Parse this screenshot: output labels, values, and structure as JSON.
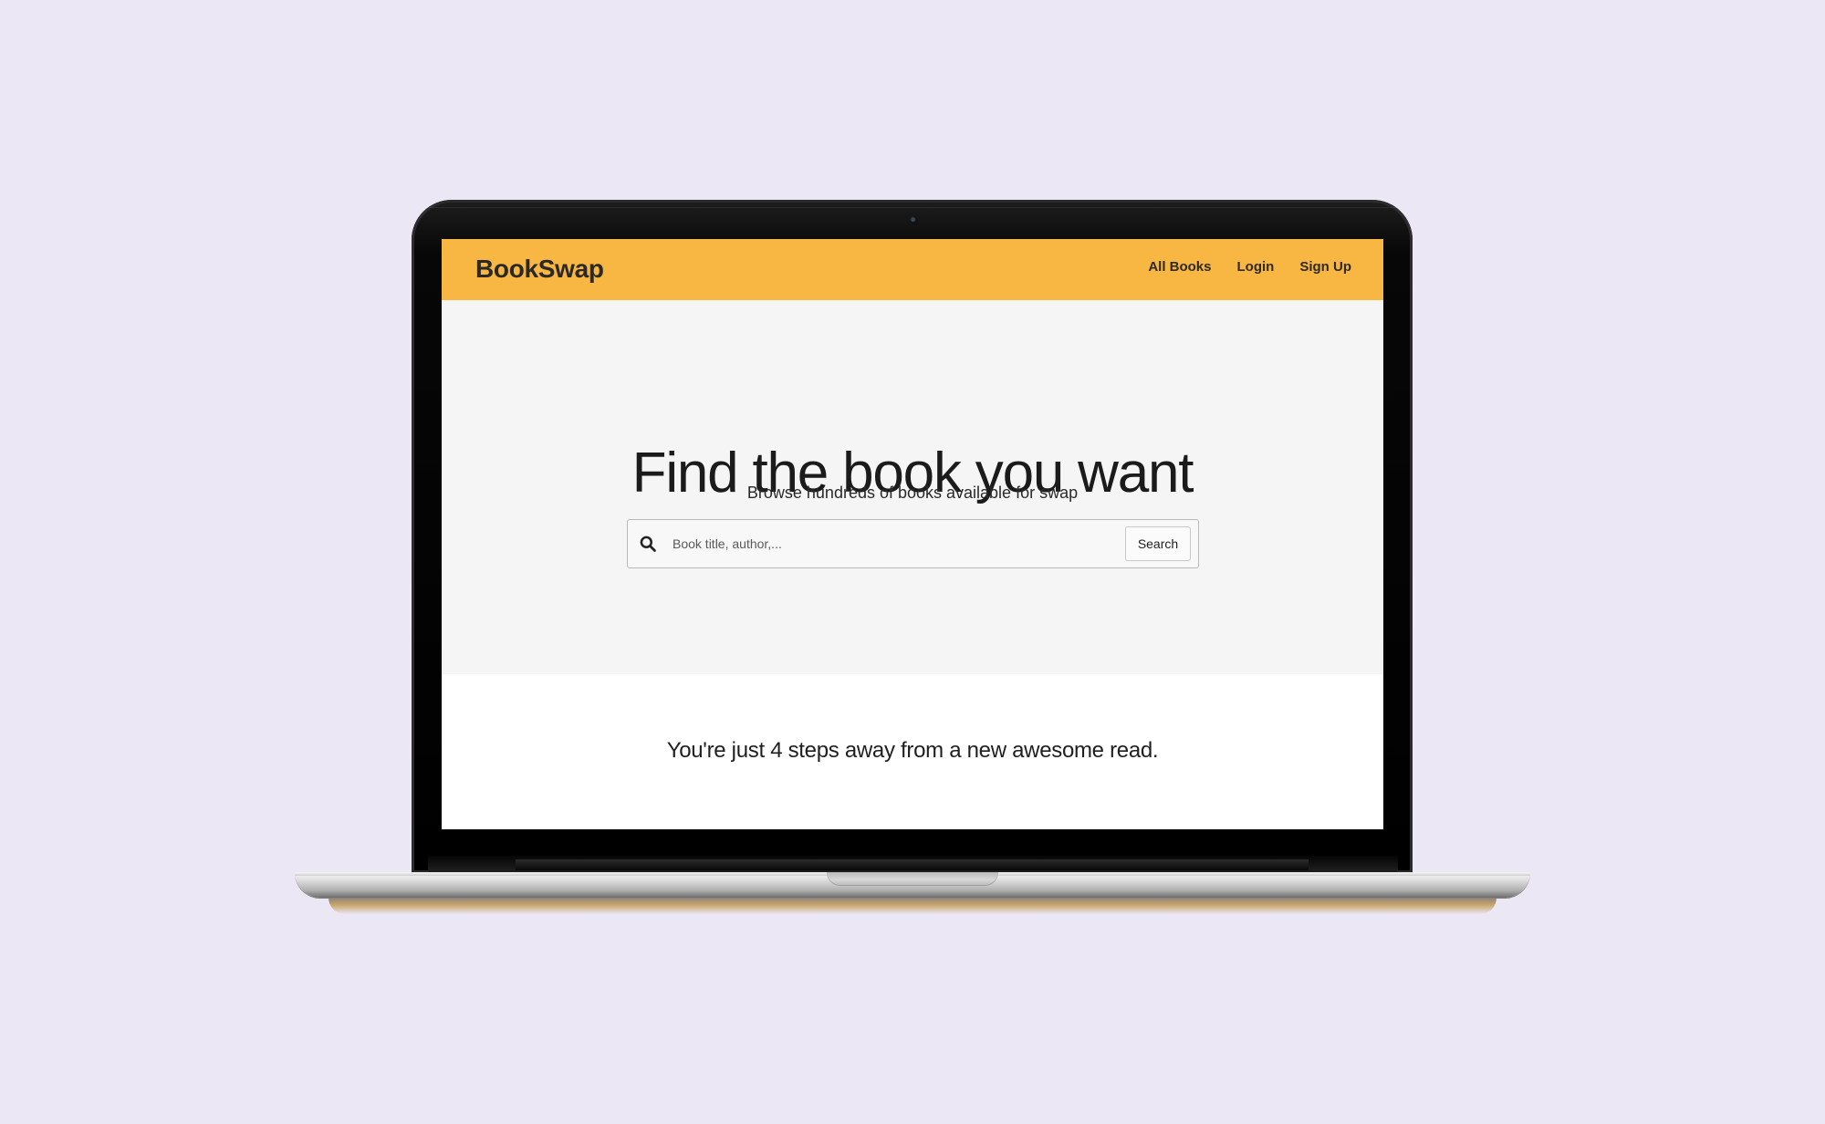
{
  "browser_content": {
    "navbar": {
      "brand": "BookSwap",
      "links": [
        {
          "label": "All Books"
        },
        {
          "label": "Login"
        },
        {
          "label": "Sign Up"
        }
      ]
    },
    "hero": {
      "title": "Find the book you want",
      "subtitle": "Browse hundreds of books available for swap",
      "search": {
        "placeholder": "Book title, author,...",
        "button_label": "Search",
        "icon": "search-icon"
      }
    },
    "steps_section": {
      "text": "You're just 4 steps away from a new awesome read."
    }
  },
  "colors": {
    "background": "#ebe7f5",
    "navbar": "#f8b743",
    "hero_background": "#f5f5f5",
    "section_background": "#ffffff"
  }
}
